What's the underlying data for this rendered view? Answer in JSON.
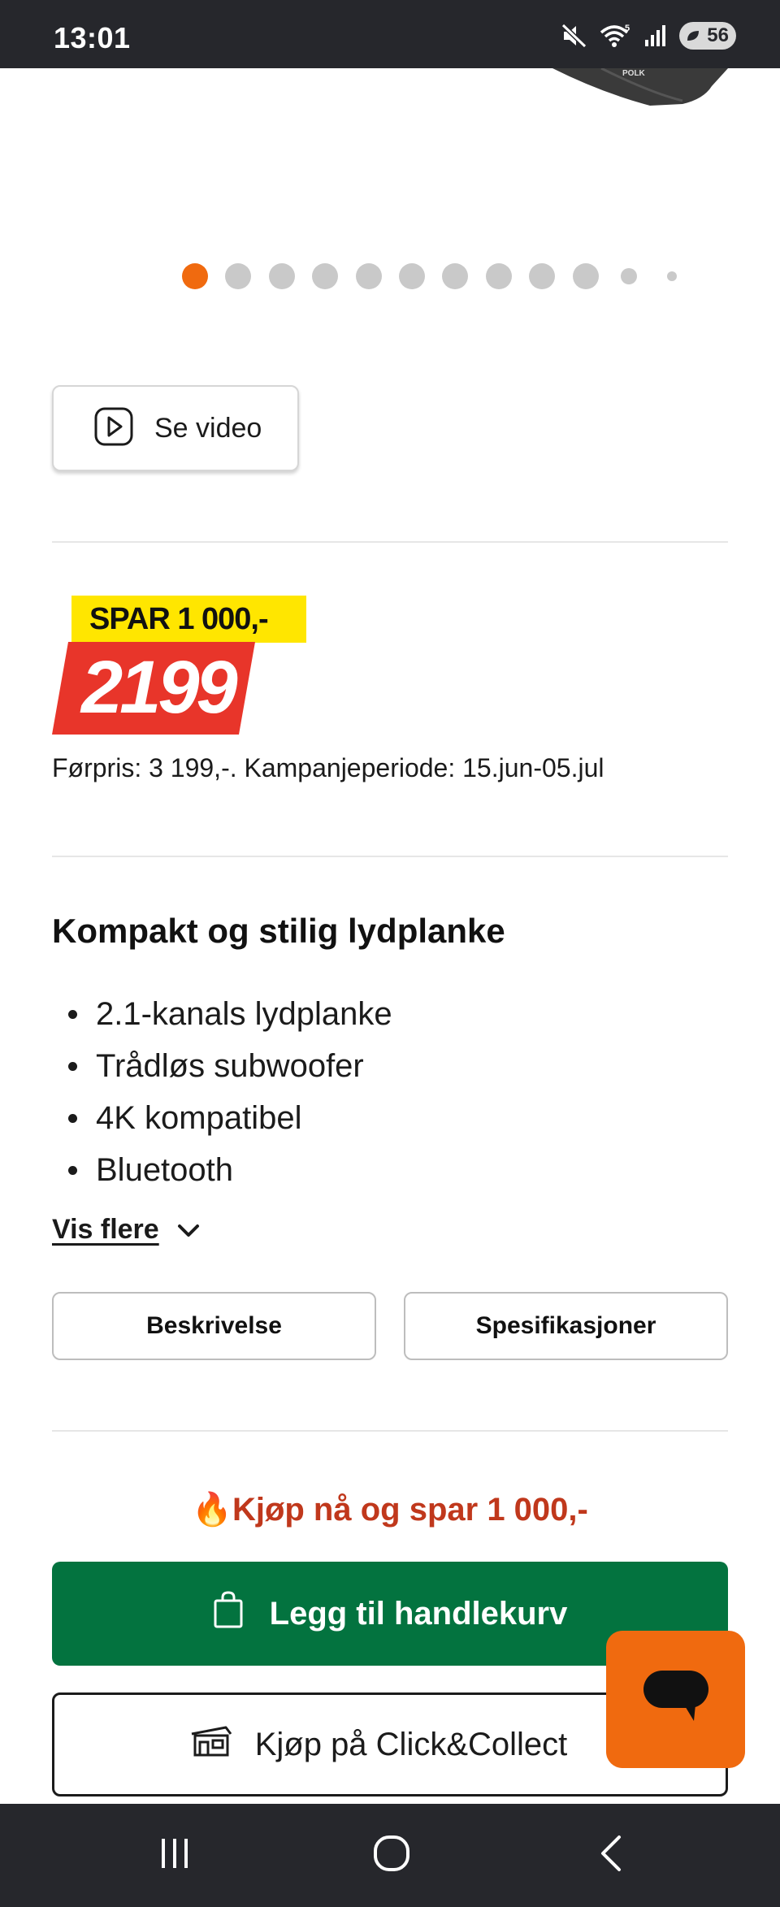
{
  "status_bar": {
    "time": "13:01",
    "battery_level": "56",
    "icons": [
      "mute-icon",
      "wifi-icon",
      "signal-icon",
      "battery-icon"
    ]
  },
  "carousel": {
    "total_dots": 12,
    "active_index": 0,
    "active_color": "#f06a0f",
    "inactive_color": "#c9c9c9"
  },
  "video": {
    "label": "Se video",
    "icon": "play-icon"
  },
  "price": {
    "save_label": "SPAR 1 000,-",
    "current": "2199",
    "previous_text": "Førpris: 3 199,-. Kampanjeperiode: 15.jun-05.jul",
    "tag_color": "#e8352a",
    "save_color": "#ffe600"
  },
  "description": {
    "title": "Kompakt og stilig lydplanke",
    "bullets": [
      "2.1-kanals lydplanke",
      "Trådløs subwoofer",
      "4K kompatibel",
      "Bluetooth"
    ],
    "more_label": "Vis flere"
  },
  "tabs": {
    "description": "Beskrivelse",
    "specs": "Spesifikasjoner"
  },
  "buy": {
    "promo_text": "Kjøp nå og spar 1 000,-",
    "promo_icon": "fire-emoji",
    "promo_color": "#c0381c",
    "cart_label": "Legg til handlekurv",
    "cart_color": "#03733f",
    "click_collect_label": "Kjøp på Click&Collect"
  },
  "chat": {
    "icon": "chat-bubble-icon",
    "color": "#f06a0f"
  },
  "nav": {
    "items": [
      "recent-apps-icon",
      "home-icon",
      "back-icon"
    ]
  }
}
